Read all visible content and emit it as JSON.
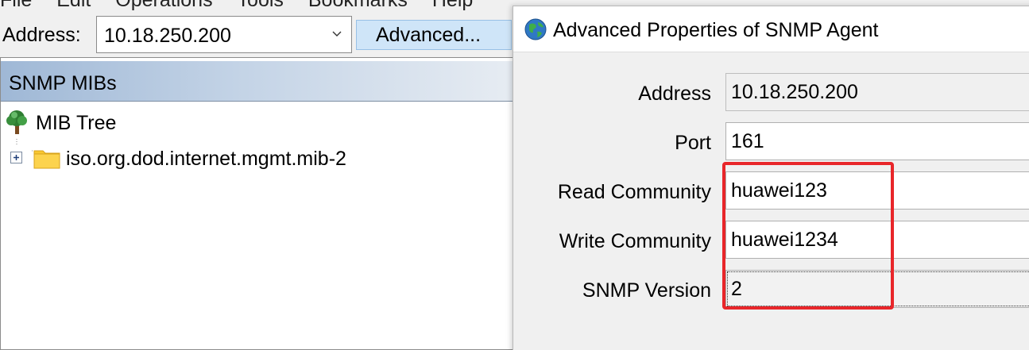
{
  "menu": {
    "items": [
      "File",
      "Edit",
      "Operations",
      "Tools",
      "Bookmarks",
      "Help"
    ]
  },
  "address_bar": {
    "label": "Address:",
    "value": "10.18.250.200",
    "advanced_label": "Advanced..."
  },
  "mib_panel": {
    "title": "SNMP MIBs",
    "root_label": "MIB Tree",
    "node_label": "iso.org.dod.internet.mgmt.mib-2"
  },
  "dialog": {
    "title": "Advanced Properties of SNMP Agent",
    "fields": [
      {
        "label": "Address",
        "value": "10.18.250.200"
      },
      {
        "label": "Port",
        "value": "161"
      },
      {
        "label": "Read Community",
        "value": "huawei123"
      },
      {
        "label": "Write Community",
        "value": "huawei1234"
      },
      {
        "label": "SNMP Version",
        "value": "2"
      }
    ]
  },
  "colors": {
    "accent_button": "#cfe5f8",
    "highlight_box": "#e8262a",
    "panel_header": "#9fb8d6"
  },
  "icons": [
    "chevron-down-icon",
    "tree-icon",
    "expand-plus-icon",
    "folder-icon",
    "globe-icon"
  ]
}
